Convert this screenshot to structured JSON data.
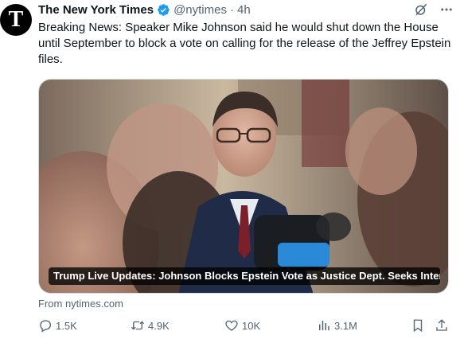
{
  "author": {
    "name": "The New York Times",
    "handle": "@nytimes",
    "separator": "·",
    "time": "4h",
    "avatar_glyph": "T"
  },
  "tweet": {
    "text": "Breaking News: Speaker Mike Johnson said he would shut down the House until September to block a vote on calling for the release of the Jeffrey Epstein files."
  },
  "card": {
    "headline": "Trump Live Updates: Johnson Blocks Epstein Vote as Justice Dept. Seeks Inter...",
    "source": "From nytimes.com"
  },
  "metrics": {
    "replies": "1.5K",
    "reposts": "4.9K",
    "likes": "10K",
    "views": "3.1M"
  },
  "icons": {
    "verified": "verified-badge-icon",
    "grok": "grok-icon",
    "more": "more-icon",
    "reply": "reply-icon",
    "repost": "repost-icon",
    "like": "heart-icon",
    "views": "views-icon",
    "bookmark": "bookmark-icon",
    "share": "share-icon"
  },
  "colors": {
    "accent": "#1d9bf0",
    "muted": "#536471",
    "text": "#0f1419"
  }
}
